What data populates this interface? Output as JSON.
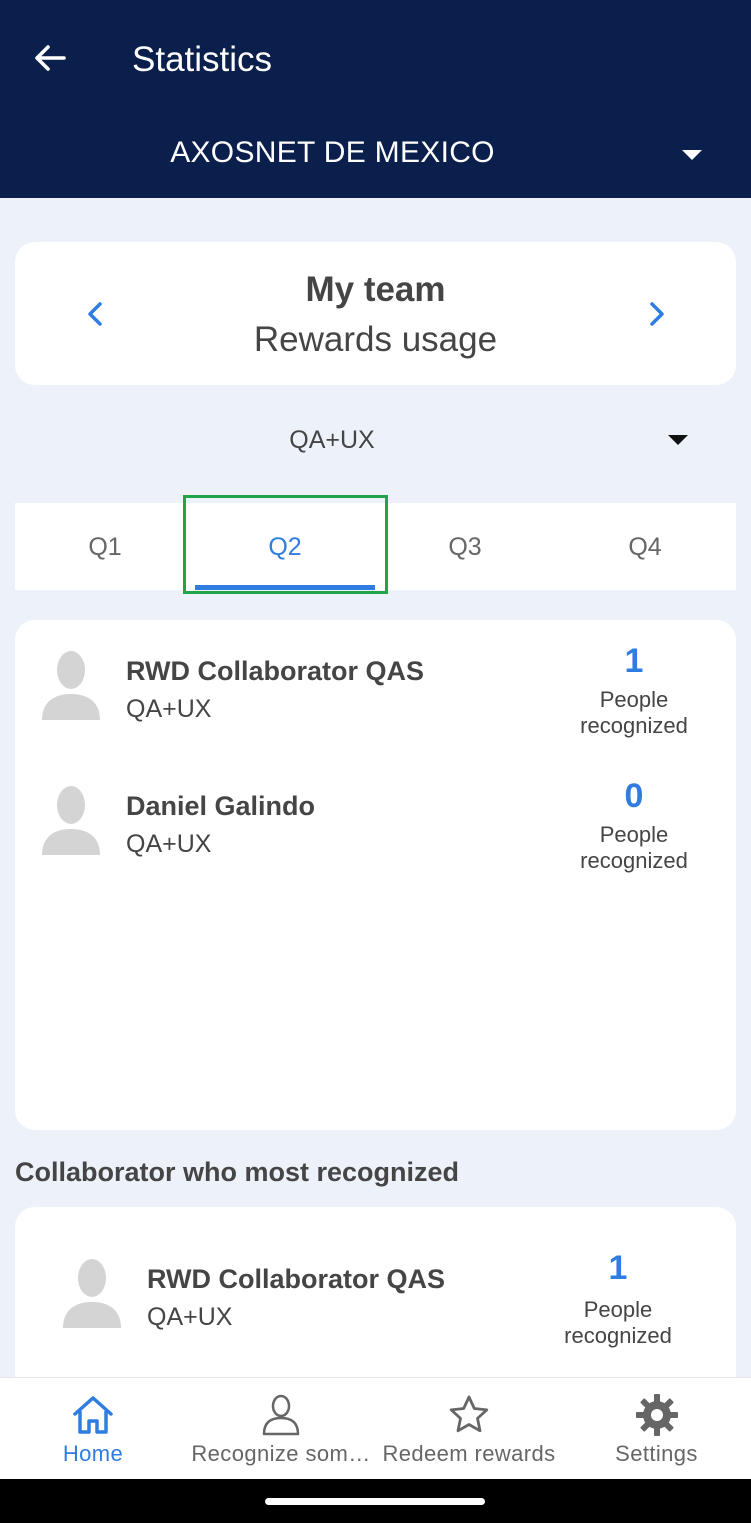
{
  "appbar": {
    "title": "Statistics",
    "company": "AXOSNET DE MEXICO"
  },
  "header_card": {
    "title": "My team",
    "subtitle": "Rewards usage"
  },
  "team_filter": {
    "selected": "QA+UX"
  },
  "tabs": [
    {
      "label": "Q1",
      "active": false
    },
    {
      "label": "Q2",
      "active": true
    },
    {
      "label": "Q3",
      "active": false
    },
    {
      "label": "Q4",
      "active": false
    }
  ],
  "team_members": [
    {
      "name": "RWD Collaborator QAS",
      "team": "QA+UX",
      "count": "1",
      "label_line1": "People",
      "label_line2": "recognized"
    },
    {
      "name": "Daniel Galindo",
      "team": "QA+UX",
      "count": "0",
      "label_line1": "People",
      "label_line2": "recognized"
    }
  ],
  "top_recognizer": {
    "section_title": "Collaborator who most recognized",
    "name": "RWD Collaborator QAS",
    "team": "QA+UX",
    "count": "1",
    "label_line1": "People",
    "label_line2": "recognized"
  },
  "bottom_nav": [
    {
      "label": "Home",
      "icon": "home-icon",
      "active": true
    },
    {
      "label": "Recognize som…",
      "icon": "person-icon",
      "active": false
    },
    {
      "label": "Redeem rewards",
      "icon": "star-icon",
      "active": false
    },
    {
      "label": "Settings",
      "icon": "gear-icon",
      "active": false
    }
  ],
  "colors": {
    "appbar": "#0b1f4d",
    "accent": "#2f7de1",
    "background": "#edf2fa",
    "focus": "#22a44a"
  }
}
